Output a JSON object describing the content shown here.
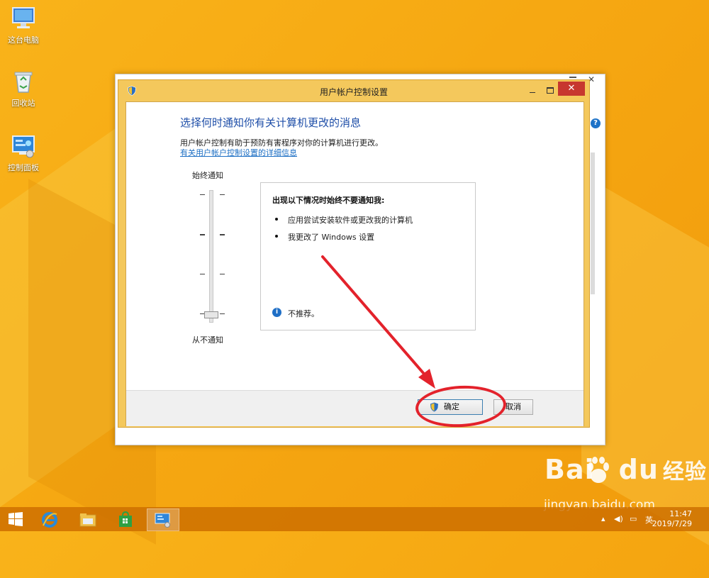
{
  "desktop": {
    "icons": [
      {
        "label": "这台电脑",
        "icon": "computer-icon"
      },
      {
        "label": "回收站",
        "icon": "recycle-bin-icon"
      },
      {
        "label": "控制面板",
        "icon": "control-panel-icon"
      }
    ]
  },
  "dialog": {
    "title": "用户帐户控制设置",
    "heading": "选择何时通知你有关计算机更改的消息",
    "description": "用户帐户控制有助于预防有害程序对你的计算机进行更改。",
    "link": "有关用户帐户控制设置的详细信息",
    "slider": {
      "top_label": "始终通知",
      "bottom_label": "从不通知",
      "levels": 4,
      "selected_level": 1
    },
    "info_box": {
      "heading": "出现以下情况时始终不要通知我:",
      "bullets": [
        "应用尝试安装软件或更改我的计算机",
        "我更改了 Windows 设置"
      ],
      "note": "不推荐。"
    },
    "buttons": {
      "ok": "确定",
      "cancel": "取消"
    },
    "close_glyph": "✕"
  },
  "taskbar": {
    "apps": [
      "start-icon",
      "internet-explorer-icon",
      "file-explorer-icon",
      "store-icon",
      "control-panel-icon"
    ],
    "ime": "英",
    "time": "11:47",
    "date": "2019/7/29"
  },
  "watermark": {
    "brand": "Bai",
    "brand2": "du",
    "product": "经验",
    "url": "jingyan.baidu.com"
  },
  "colors": {
    "accent": "#1e4ea8",
    "close_red": "#c7372f",
    "annotation_red": "#e3222b",
    "desktop": "#f6a812"
  }
}
